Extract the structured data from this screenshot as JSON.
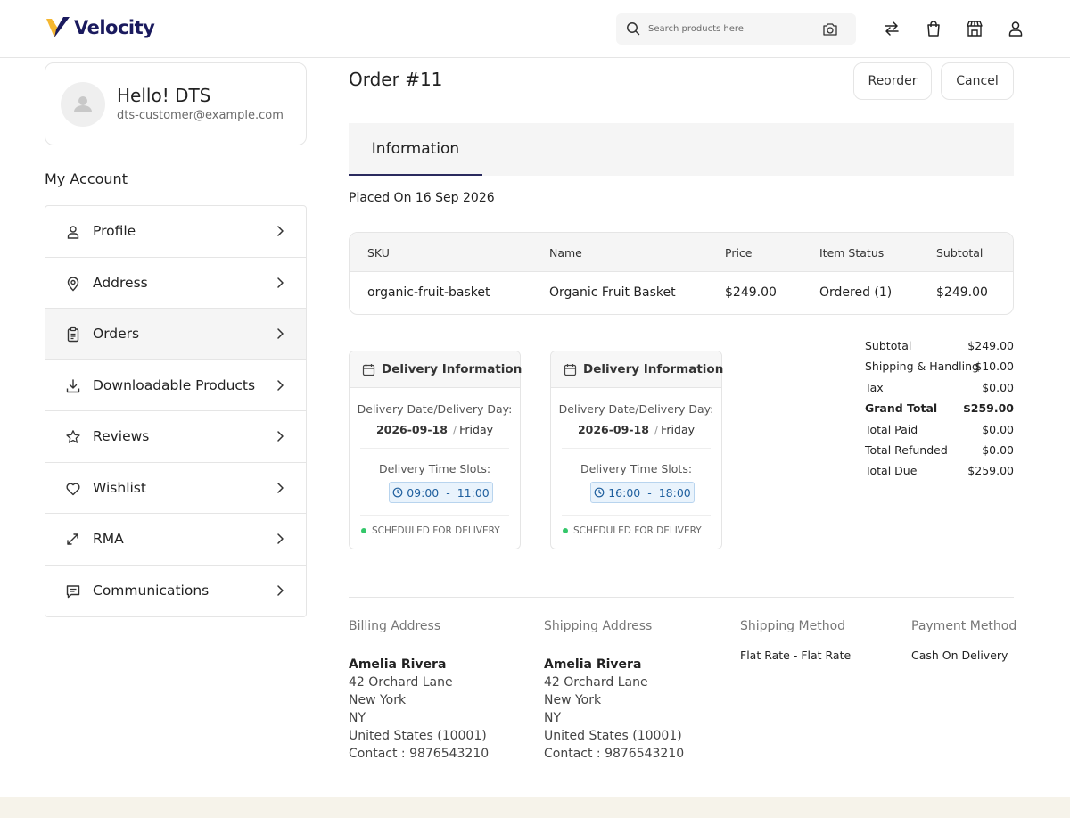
{
  "header": {
    "logo_text": "Velocity",
    "search_placeholder": "Search products here",
    "icons": [
      "search-icon",
      "camera-icon",
      "compare-icon",
      "cart-icon",
      "store-icon",
      "user-icon"
    ]
  },
  "profile": {
    "greeting": "Hello! DTS",
    "email": "dts-customer@example.com"
  },
  "sidebar": {
    "title": "My Account",
    "items": [
      {
        "label": "Profile",
        "icon": "user-icon"
      },
      {
        "label": "Address",
        "icon": "location-pin-icon"
      },
      {
        "label": "Orders",
        "icon": "clipboard-icon",
        "active": true
      },
      {
        "label": "Downloadable Products",
        "icon": "download-icon"
      },
      {
        "label": "Reviews",
        "icon": "star-icon"
      },
      {
        "label": "Wishlist",
        "icon": "heart-icon"
      },
      {
        "label": "RMA",
        "icon": "return-arrows-icon"
      },
      {
        "label": "Communications",
        "icon": "chat-icon"
      }
    ]
  },
  "order": {
    "title": "Order #11",
    "reorder_label": "Reorder",
    "cancel_label": "Cancel",
    "tab_label": "Information",
    "placed_on": "Placed On 16 Sep 2026",
    "table": {
      "headers": [
        "SKU",
        "Name",
        "Price",
        "Item Status",
        "Subtotal"
      ],
      "rows": [
        {
          "sku": "organic-fruit-basket",
          "name": "Organic Fruit Basket",
          "price": "$249.00",
          "status": "Ordered (1)",
          "subtotal": "$249.00"
        }
      ]
    }
  },
  "delivery": [
    {
      "title": "Delivery Information",
      "date_label": "Delivery Date/Delivery Day:",
      "date": "2026-09-18",
      "day": "Friday",
      "slots_label": "Delivery Time Slots:",
      "slot_start": "09:00",
      "slot_end": "11:00",
      "status": "SCHEDULED FOR DELIVERY"
    },
    {
      "title": "Delivery Information",
      "date_label": "Delivery Date/Delivery Day:",
      "date": "2026-09-18",
      "day": "Friday",
      "slots_label": "Delivery Time Slots:",
      "slot_start": "16:00",
      "slot_end": "18:00",
      "status": "SCHEDULED FOR DELIVERY"
    }
  ],
  "summary": [
    {
      "label": "Subtotal",
      "value": "$249.00"
    },
    {
      "label": "Shipping & Handling",
      "value": "$10.00"
    },
    {
      "label": "Tax",
      "value": "$0.00"
    },
    {
      "label": "Grand Total",
      "value": "$259.00",
      "bold": true
    },
    {
      "label": "Total Paid",
      "value": "$0.00"
    },
    {
      "label": "Total Refunded",
      "value": "$0.00"
    },
    {
      "label": "Total Due",
      "value": "$259.00"
    }
  ],
  "billing": {
    "heading": "Billing Address",
    "name": "Amelia Rivera",
    "street": "42 Orchard Lane",
    "city": "New York",
    "state": "NY",
    "country": "United States (10001)",
    "contact": "Contact : 9876543210"
  },
  "shipping": {
    "heading": "Shipping Address",
    "name": "Amelia Rivera",
    "street": "42 Orchard Lane",
    "city": "New York",
    "state": "NY",
    "country": "United States (10001)",
    "contact": "Contact : 9876543210"
  },
  "shipping_method": {
    "heading": "Shipping Method",
    "value": "Flat Rate - Flat Rate"
  },
  "payment_method": {
    "heading": "Payment Method",
    "value": "Cash On Delivery"
  },
  "colors": {
    "logo_yellow": "#f5b731",
    "logo_navy": "#1a1a5e",
    "tab_underline": "#2a2a5e",
    "status_dot": "#34c76a",
    "slot_blue": "#1f5f9e"
  }
}
